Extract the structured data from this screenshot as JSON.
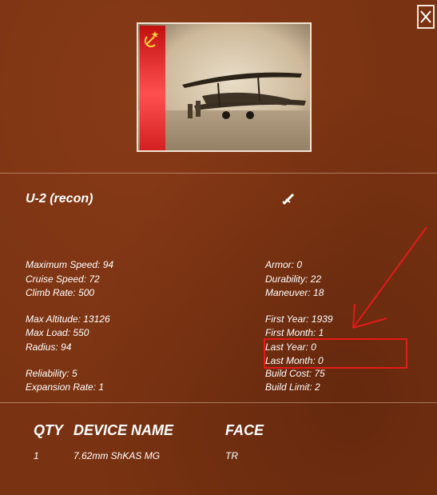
{
  "close_icon": "close-icon",
  "unit": {
    "name": "U-2 (recon)",
    "type_icon": "plane-icon"
  },
  "stats_left": [
    "Maximum Speed: 94",
    "Cruise Speed: 72",
    "Climb Rate: 500",
    "Max Altitude: 13126",
    "Max Load: 550",
    "Radius: 94",
    "Reliability: 5",
    "Expansion Rate: 1"
  ],
  "stats_right": [
    "Armor: 0",
    "Durability: 22",
    "Maneuver: 18",
    "First Year: 1939",
    "First Month: 1",
    "Last Year: 0",
    "Last Month: 0",
    "Build Cost: 75",
    "Build Limit: 2"
  ],
  "devices": {
    "headers": {
      "qty": "QTY",
      "device_name": "DEVICE NAME",
      "face": "FACE"
    },
    "rows": [
      {
        "qty": "1",
        "device_name": "7.62mm ShKAS MG",
        "face": "TR"
      }
    ]
  },
  "colors": {
    "background": "#7a3312",
    "highlight": "#e41b1b",
    "text": "#ffffff"
  }
}
